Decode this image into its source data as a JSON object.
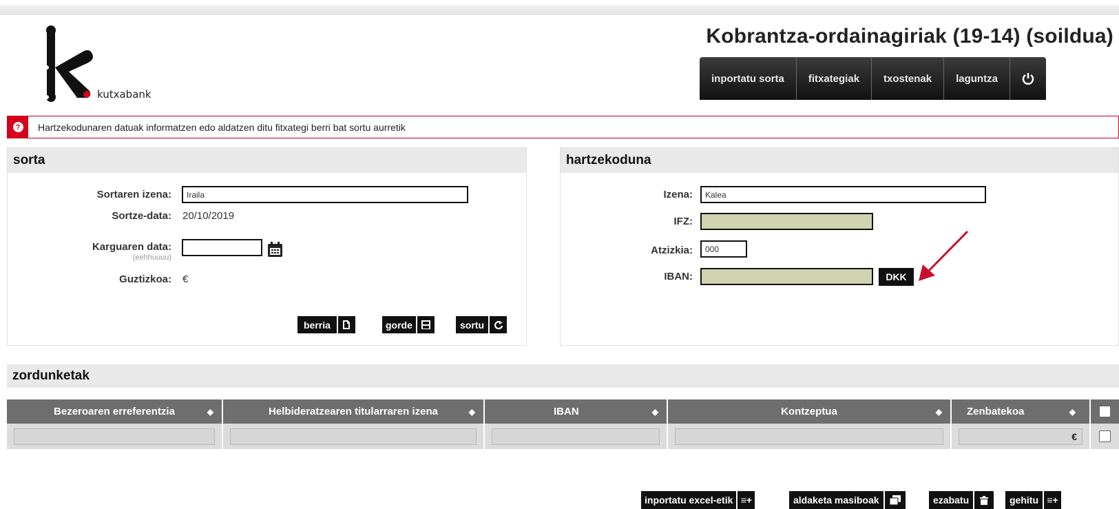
{
  "brand": {
    "logo_text": "kutxabank",
    "accent": "#d5001c"
  },
  "header": {
    "title": "Kobrantza-ordainagiriak (19-14) (soildua)"
  },
  "nav": {
    "items": [
      {
        "label": "inportatu sorta"
      },
      {
        "label": "fitxategiak"
      },
      {
        "label": "txostenak"
      },
      {
        "label": "laguntza"
      }
    ],
    "power_icon": "power-icon"
  },
  "alert": {
    "icon": "alert-icon",
    "text": "Hartzekodunaren datuak informatzen edo aldatzen ditu fitxategi berri bat sortu aurretik"
  },
  "sorta": {
    "title": "sorta",
    "name_label": "Sortaren izena:",
    "name_value": "Iraila",
    "date_label": "Sortze-data:",
    "date_value": "20/10/2019",
    "charge_label": "Karguaren data:",
    "charge_hint": "(eehhuuuu)",
    "charge_value": "",
    "total_label": "Guztizkoa:",
    "total_value": "€",
    "buttons": {
      "new": "berria",
      "save": "gorde",
      "create": "sortu"
    }
  },
  "hartzekoduna": {
    "title": "hartzekoduna",
    "name_label": "Izena:",
    "name_value": "Kalea",
    "ifz_label": "IFZ:",
    "ifz_value": "",
    "suffix_label": "Atzizkia:",
    "suffix_value": "000",
    "iban_label": "IBAN:",
    "iban_value": "",
    "dkk_label": "DKK"
  },
  "zordunketak": {
    "title": "zordunketak",
    "columns": [
      {
        "label": "Bezeroaren erreferentzia"
      },
      {
        "label": "Helbideratzearen titularraren izena"
      },
      {
        "label": "IBAN"
      },
      {
        "label": "Kontzeptua"
      },
      {
        "label": "Zenbatekoa"
      }
    ],
    "row_currency": "€"
  },
  "footer_buttons": {
    "import_excel": "inportatu excel-etik",
    "bulk_changes": "aldaketa masiboak",
    "delete": "ezabatu",
    "add": "gehitu"
  }
}
